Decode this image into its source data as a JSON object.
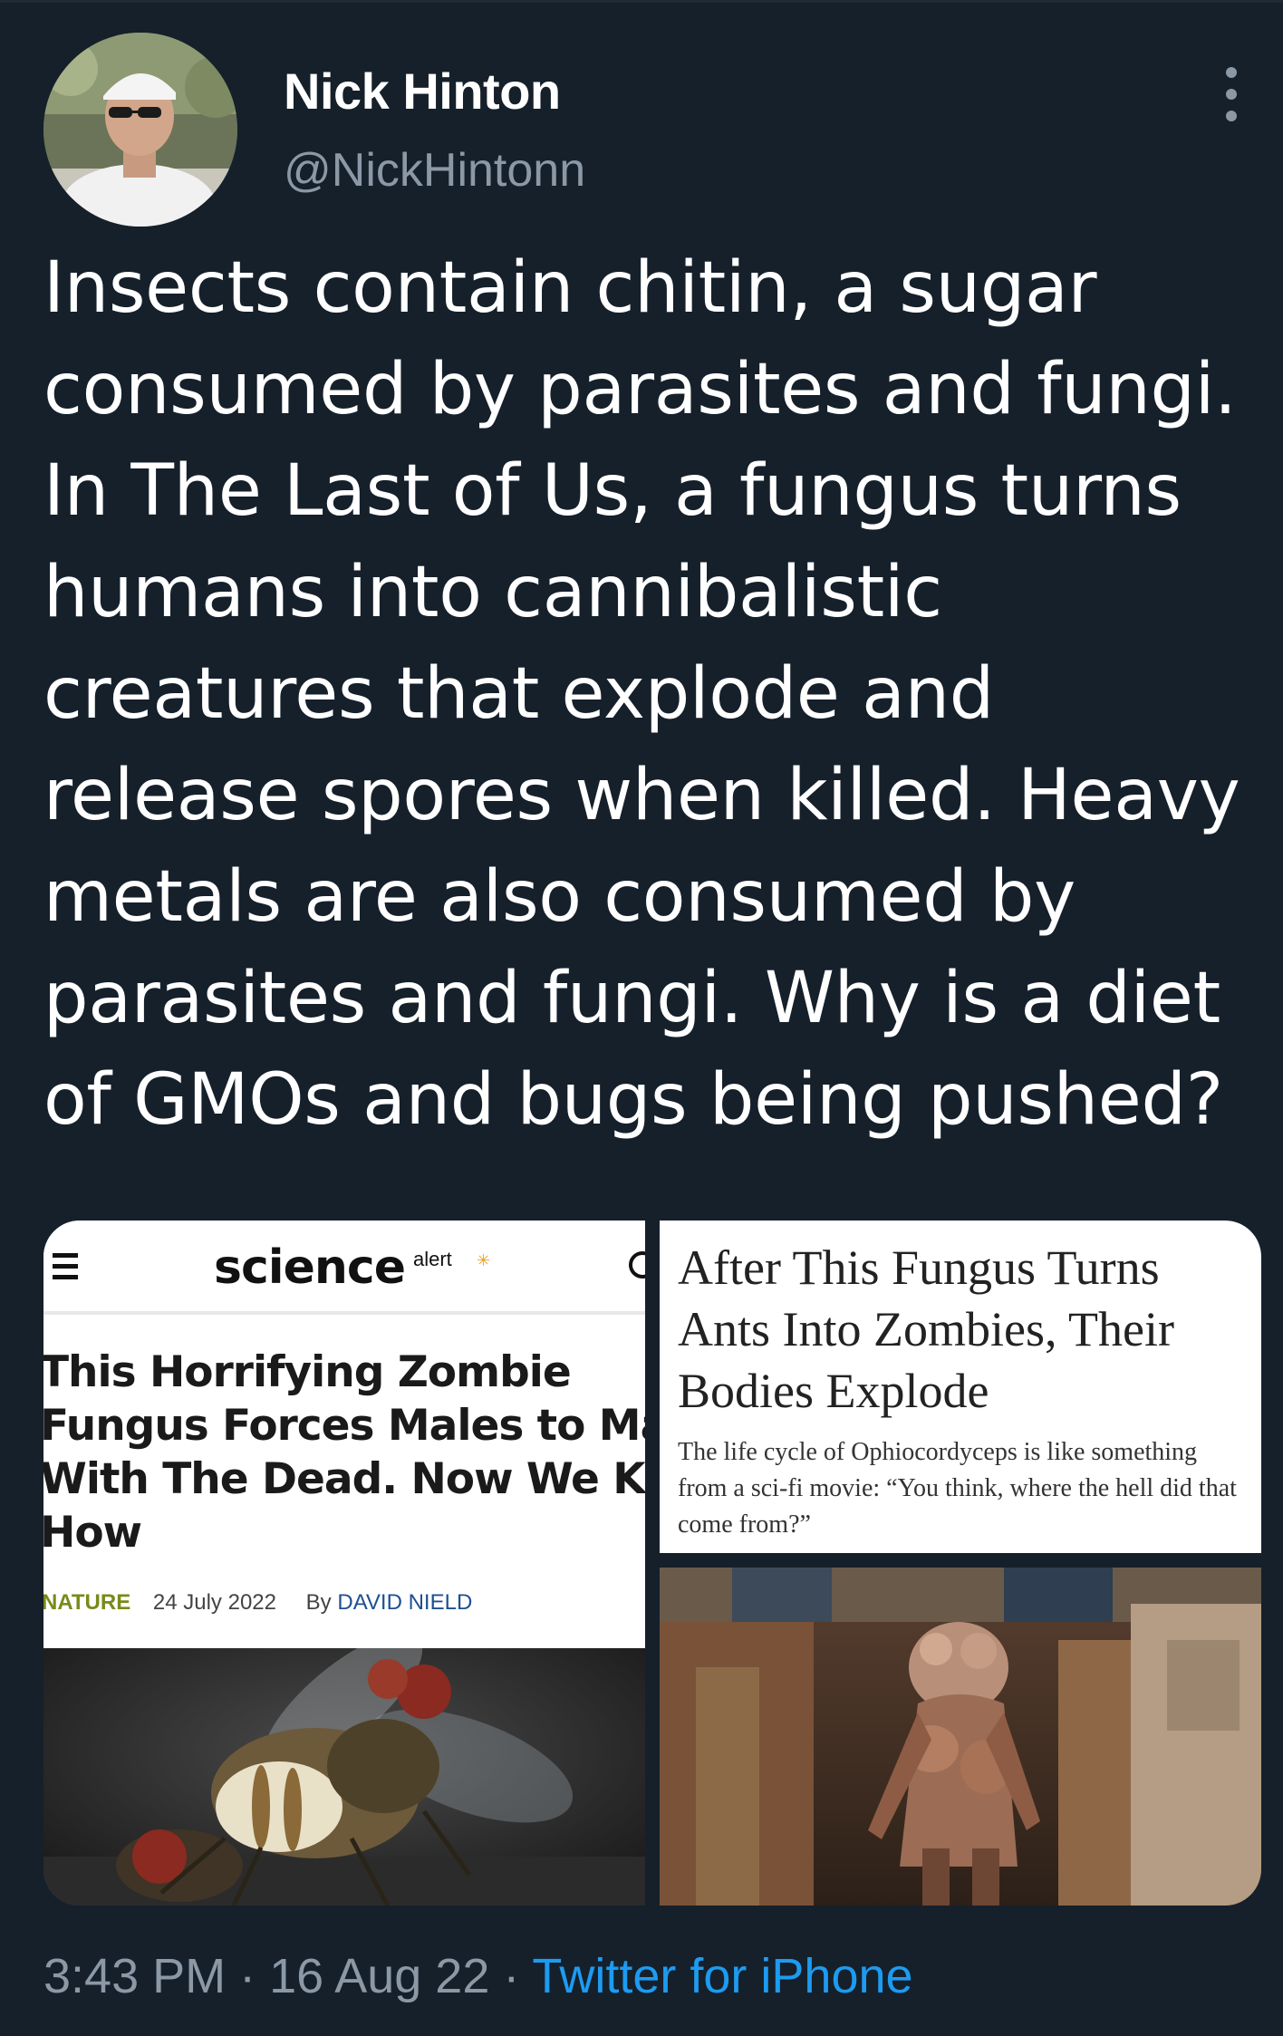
{
  "author": {
    "name": "Nick Hinton",
    "handle": "@NickHintonn"
  },
  "tweet": {
    "text": "Insects contain chitin, a sugar consumed by parasites and fungi. In The Last of Us, a fungus turns humans into cannibalistic creatures that explode and release spores when killed. Heavy metals are also consumed by parasites and fungi. Why is a diet of GMOs and bugs being pushed?"
  },
  "media": {
    "science_alert": {
      "logo": "science",
      "logo_small": "alert",
      "headline": "This Horrifying Zombie\nFungus Forces Males to Mate\nWith The Dead. Now We Know\nHow",
      "category": "NATURE",
      "date": "24 July 2022",
      "by": "By",
      "author": "DAVID NIELD"
    },
    "nyt": {
      "title": "After This Fungus Turns Ants Into Zombies, Their Bodies Explode",
      "subtitle": "The life cycle of Ophiocordyceps is like something from a sci-fi movie: “You think, where the hell did that come from?”"
    }
  },
  "footer": {
    "time": "3:43 PM",
    "sep1": " · ",
    "date": "16 Aug 22",
    "sep2": " · ",
    "source": "Twitter for iPhone"
  },
  "icons": {
    "more": "more-vertical-icon",
    "menu": "hamburger-menu-icon",
    "search": "search-icon"
  },
  "colors": {
    "background": "#15202b",
    "secondary_text": "#8b98a5",
    "link": "#1d9bf0"
  }
}
